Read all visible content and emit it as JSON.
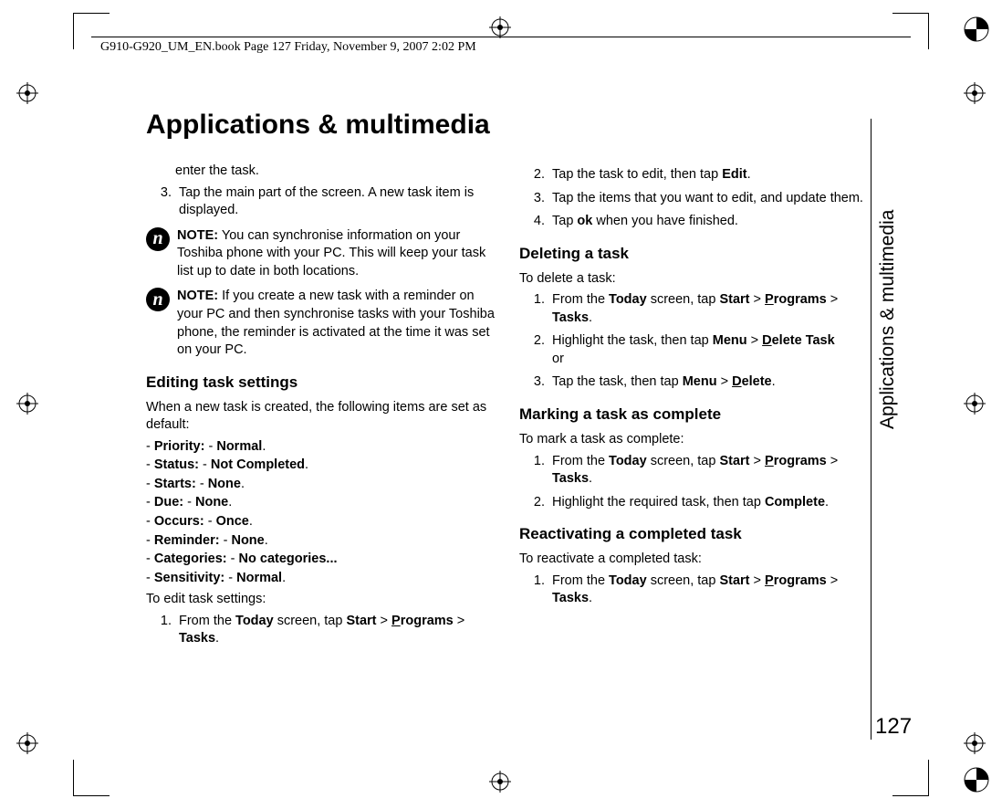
{
  "header": "G910-G920_UM_EN.book  Page 127  Friday, November 9, 2007  2:02 PM",
  "title": "Applications & multimedia",
  "sideLabel": "Applications & multimedia",
  "pageNumber": "127",
  "left": {
    "continuation": "enter the task.",
    "step3": "Tap the main part of the screen. A new task item is displayed.",
    "note1": "NOTE: You can synchronise information on your Toshiba phone with your PC. This will keep your task list up to date in both locations.",
    "note2": "NOTE: If you create a new task with a reminder on your PC and then synchronise tasks with your Toshiba phone, the reminder is activated at the time it was set on your PC.",
    "editingHeading": "Editing task settings",
    "editingIntro": "When a new task is created, the following items are set as default:",
    "defaults": {
      "priority_label": "Priority:",
      "priority_val": "Normal",
      "status_label": "Status:",
      "status_val": "Not Completed",
      "starts_label": "Starts:",
      "starts_val": "None",
      "due_label": "Due:",
      "due_val": "None",
      "occurs_label": "Occurs:",
      "occurs_val": "Once",
      "reminder_label": "Reminder:",
      "reminder_val": "None",
      "categories_label": "Categories:",
      "categories_val": "No categories...",
      "sensitivity_label": "Sensitivity:",
      "sensitivity_val": "Normal"
    },
    "toEdit": "To edit task settings:",
    "editStep1_a": "From the ",
    "editStep1_today": "Today",
    "editStep1_b": " screen, tap ",
    "editStep1_start": "Start",
    "editStep1_gt1": " > ",
    "editStep1_programs_u": "P",
    "editStep1_programs_rest": "rograms",
    "editStep1_gt2": " > ",
    "editStep1_tasks": "Tasks",
    "editStep1_period": "."
  },
  "right": {
    "step2a": "Tap the task to edit, then tap ",
    "step2b": "Edit",
    "step2c": ".",
    "step3": "Tap the items that you want to edit, and update them.",
    "step4a": "Tap ",
    "step4b": "ok",
    "step4c": " when you have finished.",
    "delHeading": "Deleting a task",
    "delIntro": "To delete a task:",
    "delStep1_a": "From the ",
    "delStep1_today": "Today",
    "delStep1_b": " screen, tap ",
    "delStep1_start": "Start",
    "delStep1_gt1": " > ",
    "delStep1_pu": "P",
    "delStep1_prest": "rograms",
    "delStep1_gt2": " > ",
    "delStep1_tasks": "Tasks",
    "delStep1_period": ".",
    "delStep2_a": "Highlight the task, then tap ",
    "delStep2_menu": "Menu",
    "delStep2_gt": " > ",
    "delStep2_du": "D",
    "delStep2_drest": "elete Task",
    "delStep2_or": "or",
    "delStep3_a": "Tap the task, then tap ",
    "delStep3_menu": "Menu",
    "delStep3_gt": " > ",
    "delStep3_du": "D",
    "delStep3_drest": "elete",
    "delStep3_period": ".",
    "markHeading": "Marking a task as complete",
    "markIntro": "To mark a task as complete:",
    "markStep1_a": "From the ",
    "markStep1_today": "Today",
    "markStep1_b": " screen, tap ",
    "markStep1_start": "Start",
    "markStep1_gt1": " > ",
    "markStep1_pu": "P",
    "markStep1_prest": "rograms",
    "markStep1_gt2": " > ",
    "markStep1_tasks": "Tasks",
    "markStep1_period": ".",
    "markStep2_a": "Highlight the required task, then tap ",
    "markStep2_complete": "Complete",
    "markStep2_period": ".",
    "reactHeading": "Reactivating a completed task",
    "reactIntro": "To reactivate a completed task:",
    "reactStep1_a": "From the ",
    "reactStep1_today": "Today",
    "reactStep1_b": " screen, tap ",
    "reactStep1_start": "Start",
    "reactStep1_gt1": " > ",
    "reactStep1_pu": "P",
    "reactStep1_prest": "rograms",
    "reactStep1_gt2": " > ",
    "reactStep1_tasks": "Tasks",
    "reactStep1_period": "."
  }
}
